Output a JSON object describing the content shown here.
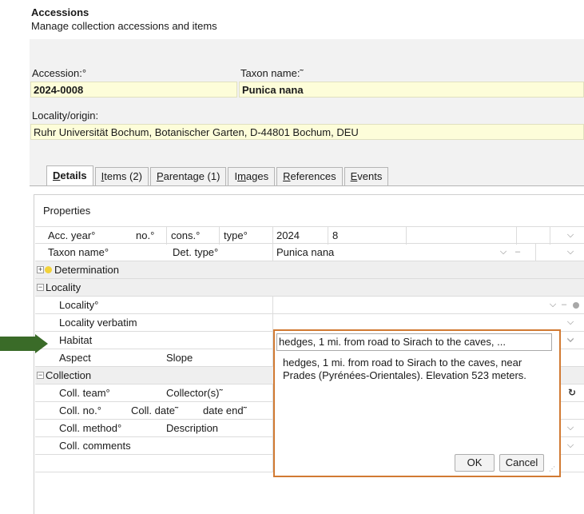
{
  "header": {
    "title": "Accessions",
    "subtitle": "Manage collection accessions and items"
  },
  "form": {
    "accession_label": "Accession:°",
    "accession_value": "2024-0008",
    "taxon_label": "Taxon name:˜",
    "taxon_value": "Punica nana",
    "locality_label": "Locality/origin:",
    "locality_value": "Ruhr Universität Bochum, Botanischer Garten, D-44801 Bochum, DEU"
  },
  "tabs": [
    {
      "pre": "",
      "ul": "D",
      "post": "etails",
      "active": true
    },
    {
      "pre": "",
      "ul": "I",
      "post": "tems (2)",
      "active": false
    },
    {
      "pre": "",
      "ul": "P",
      "post": "arentage (1)",
      "active": false
    },
    {
      "pre": "I",
      "ul": "m",
      "post": "ages",
      "active": false
    },
    {
      "pre": "",
      "ul": "R",
      "post": "eferences",
      "active": false
    },
    {
      "pre": "",
      "ul": "E",
      "post": "vents",
      "active": false
    }
  ],
  "properties": {
    "title": "Properties",
    "acc_year_label": "Acc. year°",
    "no_label": "no.°",
    "cons_label": "cons.°",
    "type_label": "type°",
    "acc_year_value": "2024",
    "no_value": "8",
    "taxon_name_label": "Taxon name°",
    "det_type_label": "Det. type°",
    "taxon_name_value": "Punica nana",
    "determination_group": "Determination",
    "locality_group": "Locality",
    "locality_label": "Locality°",
    "locality_verbatim_label": "Locality verbatim",
    "habitat_label": "Habitat",
    "aspect_label": "Aspect",
    "slope_label": "Slope",
    "collection_group": "Collection",
    "coll_team_label": "Coll. team°",
    "collectors_label": "Collector(s)˜",
    "coll_no_label": "Coll. no.°",
    "coll_date_label": "Coll. date˜",
    "date_end_label": "date end˜",
    "coll_method_label": "Coll. method°",
    "description_label": "Description",
    "coll_comments_label": "Coll. comments"
  },
  "popup": {
    "summary": "hedges, 1 mi. from road to Sirach to the caves, ...",
    "text": "hedges, 1 mi. from road to Sirach to the caves, near Prades (Pyrénées-Orientales). Elevation 523 meters.",
    "ok_label": "OK",
    "cancel_label": "Cancel"
  },
  "colors": {
    "highlight_border": "#d17a33",
    "arrow": "#3a6b28",
    "required_field_bg": "#fdfdd9"
  },
  "icons": {
    "expand": "plus-box-icon",
    "collapse": "minus-box-icon",
    "status": "yellow-dot-icon",
    "dropdown": "chevron-down-icon",
    "refresh": "refresh-icon"
  }
}
